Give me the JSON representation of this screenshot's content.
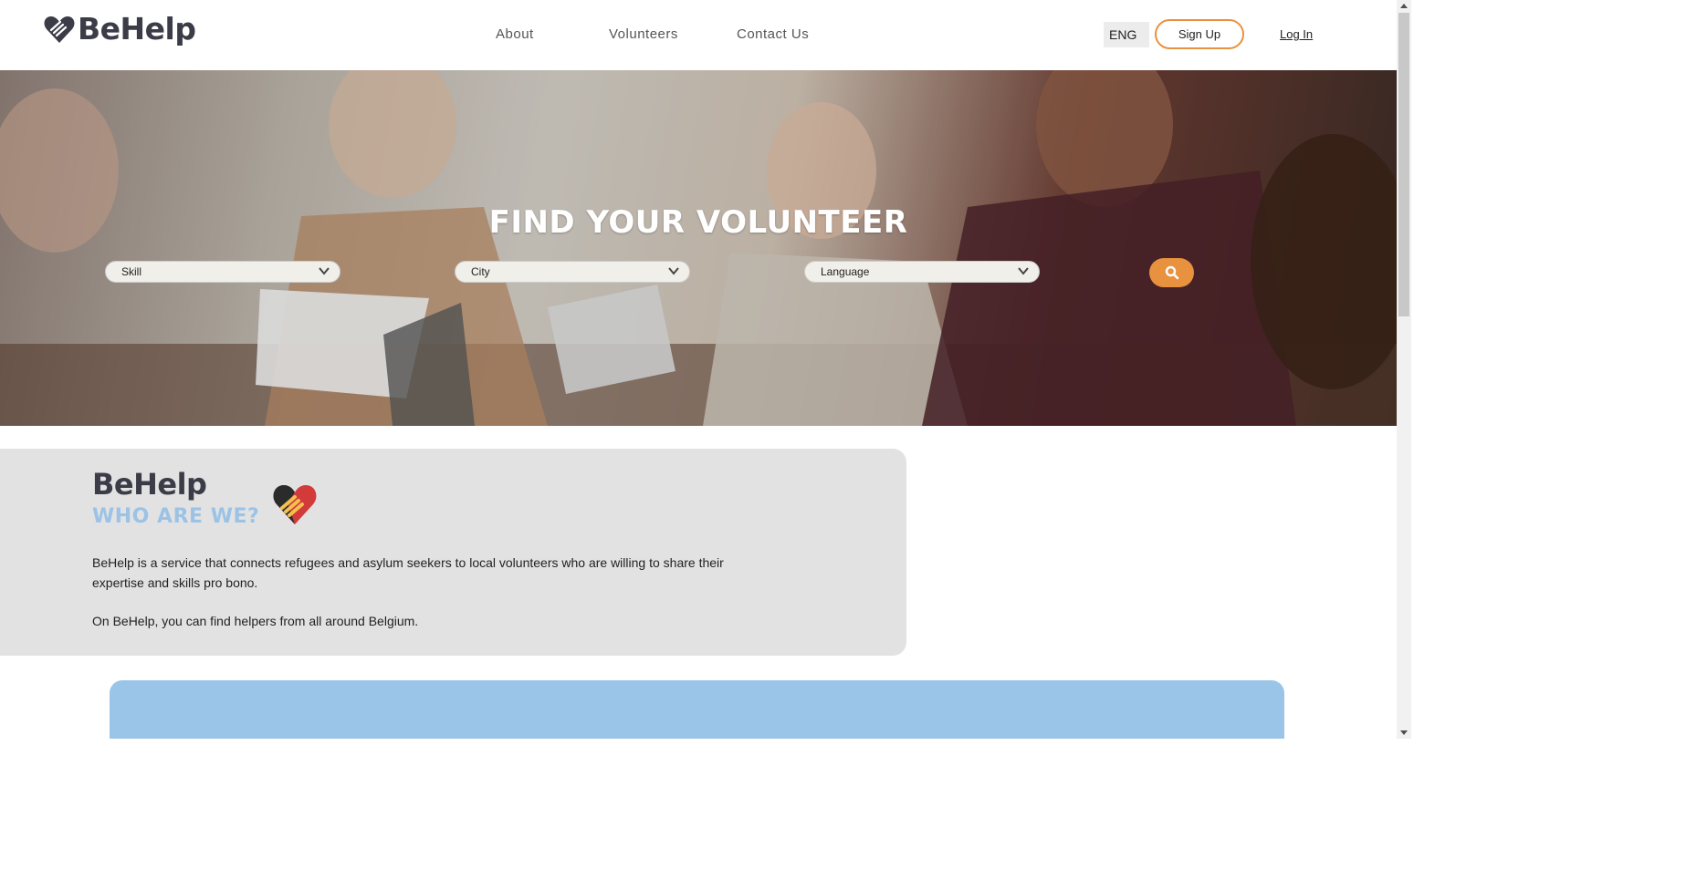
{
  "header": {
    "brand": "BeHelp",
    "nav": {
      "about": "About",
      "volunteers": "Volunteers",
      "contact": "Contact Us"
    },
    "language": "ENG",
    "signup_label": "Sign Up",
    "login_label": "Log In"
  },
  "hero": {
    "title": "FIND YOUR VOLUNTEER",
    "filters": {
      "skill": "Skill",
      "city": "City",
      "language": "Language"
    },
    "search_icon": "search-icon"
  },
  "about": {
    "title": "BeHelp",
    "subtitle": "WHO ARE WE?",
    "paragraph1": "BeHelp is a service that connects refugees and asylum seekers to local volunteers who are willing to share their expertise and skills pro bono.",
    "paragraph2": "On BeHelp, you can find helpers from all around Belgium."
  },
  "colors": {
    "accent_orange": "#e8913e",
    "brand_dark": "#3c3c48",
    "light_blue": "#9cc3e6",
    "card_gray": "#e2e2e2"
  }
}
